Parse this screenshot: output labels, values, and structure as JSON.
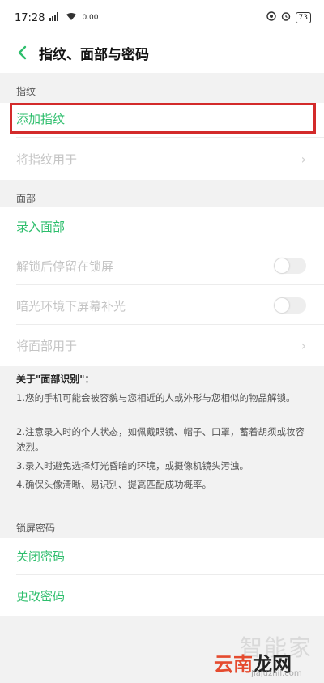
{
  "status_bar": {
    "time": "17:28",
    "signal_icon": "signal-bars-icon",
    "wifi_icon": "wifi-icon",
    "network_speed": "0.00",
    "right_icons": [
      "location-icon",
      "alarm-icon"
    ],
    "battery": "73"
  },
  "header": {
    "back_icon": "chevron-left-icon",
    "title": "指纹、面部与密码"
  },
  "fingerprint": {
    "section_label": "指纹",
    "add_label": "添加指纹",
    "use_label": "将指纹用于"
  },
  "face": {
    "section_label": "面部",
    "enroll_label": "录入面部",
    "stay_on_lock_label": "解锁后停留在锁屏",
    "dark_fill_light_label": "暗光环境下屏幕补光",
    "use_label": "将面部用于",
    "stay_on_lock_enabled": false,
    "dark_fill_light_enabled": false
  },
  "about": {
    "title": "关于\"面部识别\"：",
    "items": [
      "1.您的手机可能会被容貌与您相近的人或外形与您相似的物品解锁。",
      "2.注意录入时的个人状态，如佩戴眼镜、帽子、口罩，蓄着胡须或妆容浓烈。",
      "3.录入时避免选择灯光昏暗的环境，或摄像机镜头污浊。",
      "4.确保头像清晰、易识别、提高匹配成功概率。"
    ]
  },
  "lock_password": {
    "section_label": "锁屏密码",
    "turn_off_label": "关闭密码",
    "change_label": "更改密码"
  },
  "colors": {
    "accent_green": "#2dbe6c",
    "highlight_red": "#d32a2a"
  },
  "watermark": {
    "top": "智能家",
    "brand_main": "云南",
    "brand_accent": "龙网",
    "url": "Jiajuzhil.com"
  }
}
